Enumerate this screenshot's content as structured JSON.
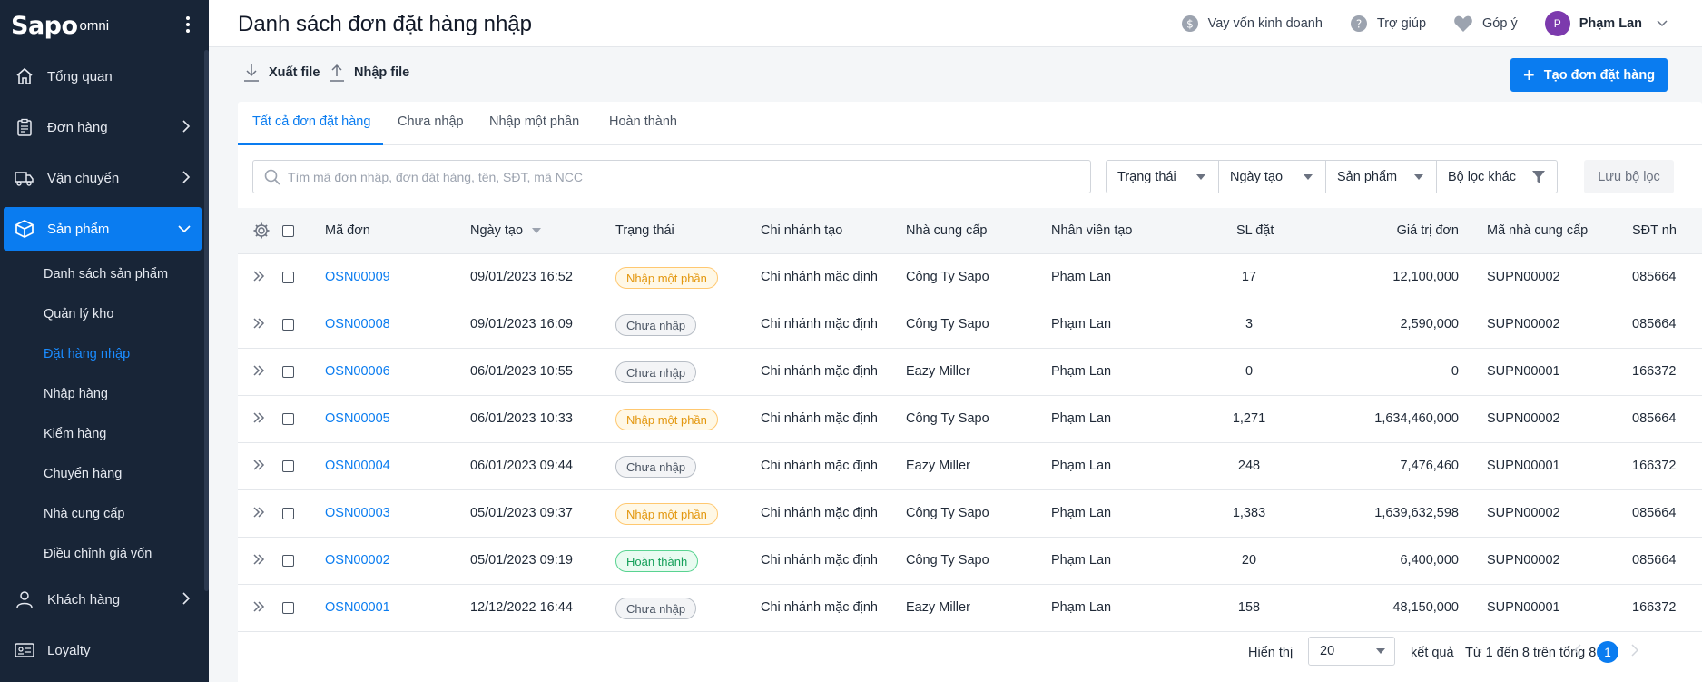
{
  "sidebar": {
    "logo": "Sapo",
    "logo_suffix": "omni",
    "items": [
      {
        "label": "Tổng quan"
      },
      {
        "label": "Đơn hàng"
      },
      {
        "label": "Vận chuyển"
      },
      {
        "label": "Sản phẩm"
      },
      {
        "label": "Khách hàng"
      },
      {
        "label": "Loyalty"
      }
    ],
    "sub_items": [
      {
        "label": "Danh sách sản phẩm"
      },
      {
        "label": "Quản lý kho"
      },
      {
        "label": "Đặt hàng nhập"
      },
      {
        "label": "Nhập hàng"
      },
      {
        "label": "Kiểm hàng"
      },
      {
        "label": "Chuyển hàng"
      },
      {
        "label": "Nhà cung cấp"
      },
      {
        "label": "Điều chỉnh giá vốn"
      }
    ]
  },
  "header": {
    "title": "Danh sách đơn đặt hàng nhập",
    "loan": "Vay vốn kinh doanh",
    "help": "Trợ giúp",
    "feedback": "Góp ý",
    "avatar_letter": "P",
    "user_name": "Phạm Lan"
  },
  "toolbar": {
    "export": "Xuất file",
    "import": "Nhập file",
    "create": "Tạo đơn đặt hàng"
  },
  "tabs": [
    "Tất cả đơn đặt hàng",
    "Chưa nhập",
    "Nhập một phần",
    "Hoàn thành"
  ],
  "search": {
    "placeholder": "Tìm mã đơn nhập, đơn đặt hàng, tên, SĐT, mã NCC"
  },
  "filters": [
    "Trạng thái",
    "Ngày tạo",
    "Sản phẩm",
    "Bộ lọc khác"
  ],
  "save_filter": "Lưu bộ lọc",
  "columns": [
    "Mã đơn",
    "Ngày tạo",
    "Trạng thái",
    "Chi nhánh tạo",
    "Nhà cung cấp",
    "Nhân viên tạo",
    "SL đặt",
    "Giá trị đơn",
    "Mã nhà cung cấp",
    "SĐT nh"
  ],
  "rows": [
    {
      "code": "OSN00009",
      "date": "09/01/2023 16:52",
      "status": "Nhập một phần",
      "status_type": "partial",
      "branch": "Chi nhánh mặc định",
      "supplier": "Công Ty Sapo",
      "staff": "Phạm Lan",
      "qty": "17",
      "value": "12,100,000",
      "supplier_code": "SUPN00002",
      "phone": "085664"
    },
    {
      "code": "OSN00008",
      "date": "09/01/2023 16:09",
      "status": "Chưa nhập",
      "status_type": "pending",
      "branch": "Chi nhánh mặc định",
      "supplier": "Công Ty Sapo",
      "staff": "Phạm Lan",
      "qty": "3",
      "value": "2,590,000",
      "supplier_code": "SUPN00002",
      "phone": "085664"
    },
    {
      "code": "OSN00006",
      "date": "06/01/2023 10:55",
      "status": "Chưa nhập",
      "status_type": "pending",
      "branch": "Chi nhánh mặc định",
      "supplier": "Eazy Miller",
      "staff": "Phạm Lan",
      "qty": "0",
      "value": "0",
      "supplier_code": "SUPN00001",
      "phone": "166372"
    },
    {
      "code": "OSN00005",
      "date": "06/01/2023 10:33",
      "status": "Nhập một phần",
      "status_type": "partial",
      "branch": "Chi nhánh mặc định",
      "supplier": "Công Ty Sapo",
      "staff": "Phạm Lan",
      "qty": "1,271",
      "value": "1,634,460,000",
      "supplier_code": "SUPN00002",
      "phone": "085664"
    },
    {
      "code": "OSN00004",
      "date": "06/01/2023 09:44",
      "status": "Chưa nhập",
      "status_type": "pending",
      "branch": "Chi nhánh mặc định",
      "supplier": "Eazy Miller",
      "staff": "Phạm Lan",
      "qty": "248",
      "value": "7,476,460",
      "supplier_code": "SUPN00001",
      "phone": "166372"
    },
    {
      "code": "OSN00003",
      "date": "05/01/2023 09:37",
      "status": "Nhập một phần",
      "status_type": "partial",
      "branch": "Chi nhánh mặc định",
      "supplier": "Công Ty Sapo",
      "staff": "Phạm Lan",
      "qty": "1,383",
      "value": "1,639,632,598",
      "supplier_code": "SUPN00002",
      "phone": "085664"
    },
    {
      "code": "OSN00002",
      "date": "05/01/2023 09:19",
      "status": "Hoàn thành",
      "status_type": "done",
      "branch": "Chi nhánh mặc định",
      "supplier": "Công Ty Sapo",
      "staff": "Phạm Lan",
      "qty": "20",
      "value": "6,400,000",
      "supplier_code": "SUPN00002",
      "phone": "085664"
    },
    {
      "code": "OSN00001",
      "date": "12/12/2022 16:44",
      "status": "Chưa nhập",
      "status_type": "pending",
      "branch": "Chi nhánh mặc định",
      "supplier": "Eazy Miller",
      "staff": "Phạm Lan",
      "qty": "158",
      "value": "48,150,000",
      "supplier_code": "SUPN00001",
      "phone": "166372"
    }
  ],
  "pagination": {
    "show_label": "Hiển thị",
    "page_size": "20",
    "results_label": "kết quả",
    "range_text": "Từ 1 đến 8 trên tổng 8",
    "current_page": "1"
  }
}
